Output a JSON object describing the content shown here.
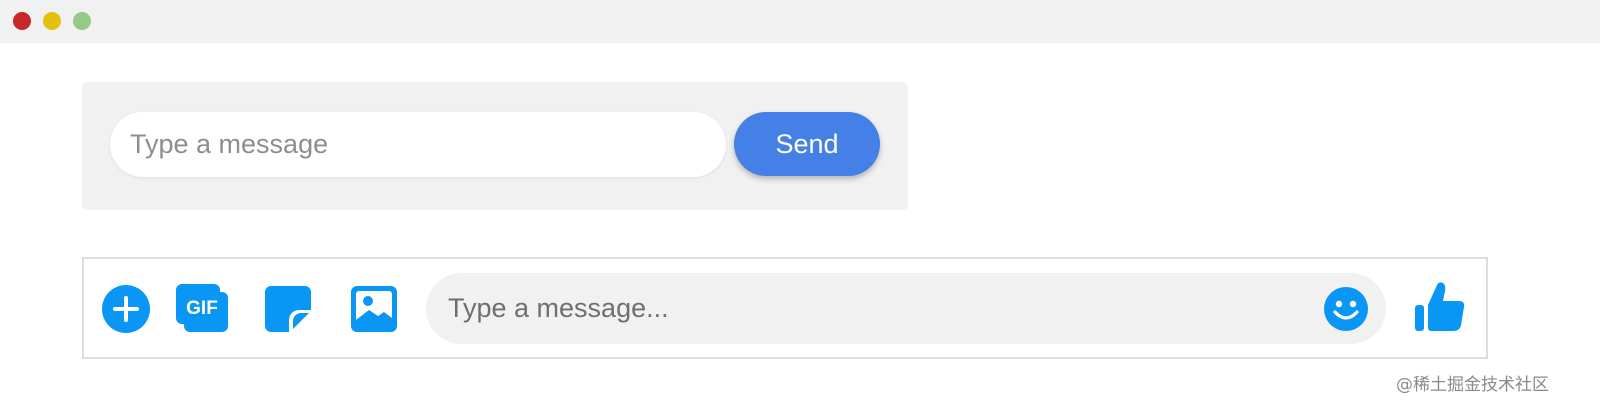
{
  "window": {
    "controls": [
      "close",
      "minimize",
      "maximize"
    ],
    "colors": {
      "close": "#c8262b",
      "minimize": "#e4c10c",
      "maximize": "#94c988"
    }
  },
  "composer_simple": {
    "placeholder": "Type a message",
    "send_label": "Send",
    "accent": "#4480e6"
  },
  "composer_messenger": {
    "placeholder": "Type a message...",
    "icons": [
      "plus-icon",
      "gif-icon",
      "sticker-icon",
      "image-icon",
      "emoji-icon",
      "thumbs-up-icon"
    ],
    "gif_text": "GIF",
    "accent": "#0a96f4"
  },
  "watermark": "@稀土掘金技术社区"
}
